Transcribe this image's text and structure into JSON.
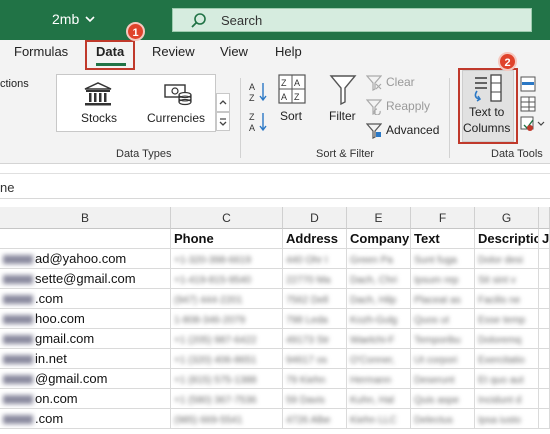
{
  "titlebar": {
    "filename": "2mb",
    "search_placeholder": "Search"
  },
  "tabs": [
    {
      "label": "Formulas"
    },
    {
      "label": "Data",
      "active": true
    },
    {
      "label": "Review"
    },
    {
      "label": "View"
    },
    {
      "label": "Help"
    }
  ],
  "callouts": {
    "data_tab": "1",
    "text_to_columns": "2"
  },
  "ribbon": {
    "partial_left_label": "ctions",
    "data_types": {
      "group_label": "Data Types",
      "stocks": "Stocks",
      "currencies": "Currencies"
    },
    "sort_filter": {
      "group_label": "Sort & Filter",
      "sort": "Sort",
      "filter": "Filter",
      "clear": "Clear",
      "reapply": "Reapply",
      "advanced": "Advanced"
    },
    "data_tools": {
      "group_label": "Data Tools",
      "text_to_columns_line1": "Text to",
      "text_to_columns_line2": "Columns"
    }
  },
  "formula_bar": {
    "name_box": "ne"
  },
  "columns": [
    "B",
    "C",
    "D",
    "E",
    "F",
    "G"
  ],
  "header_row": [
    "",
    "Phone",
    "Address",
    "Company",
    "Text",
    "Descriptic",
    "J"
  ],
  "rows": [
    {
      "email": "ad@yahoo.com",
      "cells": [
        "+1-320-398-6619",
        "440 Ohr I",
        "Green Pa",
        "Sunt fuga",
        "Dolor desi"
      ]
    },
    {
      "email": "sette@gmail.com",
      "cells": [
        "+1-419-815-9540",
        "22770 Ma",
        "Dach, Chri",
        "Ipsum rep",
        "Sit sint v"
      ]
    },
    {
      "email": ".com",
      "cells": [
        "(947) 444-2201",
        "7562 Dell",
        "Dach, Hilp",
        "Placeat as",
        "Facilis ne"
      ]
    },
    {
      "email": "hoo.com",
      "cells": [
        "1-808-346-2079",
        "798 Leda",
        "Kozh-Gulg",
        "Quos ut",
        "Esse temp"
      ]
    },
    {
      "email": "gmail.com",
      "cells": [
        "+1 (205) 987-6422",
        "49173 Str",
        "Waelchi-F",
        "Temporibu",
        "Doloremq"
      ]
    },
    {
      "email": "in.net",
      "cells": [
        "+1 (320) 406-8651",
        "94617 os",
        "O'Conner,",
        "Ut corpori",
        "Exercitatio"
      ]
    },
    {
      "email": "@gmail.com",
      "cells": [
        "+1 (815) 575-1388",
        "79 Kiehn",
        "Hermann",
        "Deserunt",
        "Et quo aut"
      ]
    },
    {
      "email": "on.com",
      "cells": [
        "+1 (580) 367-7536",
        "59 Davis",
        "Kuhn, Hal",
        "Quis aspe",
        "Incidunt d"
      ]
    },
    {
      "email": ".com",
      "cells": [
        "(985) 669-5541",
        "4726 Albe",
        "Kiehn LLC",
        "Delectus",
        "Ipsa iusto"
      ]
    }
  ],
  "colors": {
    "excel_green": "#217346",
    "callout_red": "#e0432b",
    "highlight_blue": "#2b78c5"
  }
}
